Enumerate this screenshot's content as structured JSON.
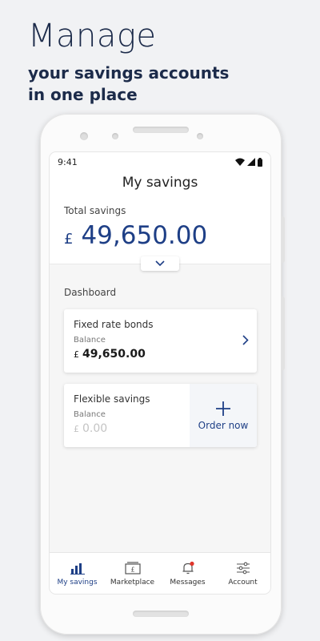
{
  "promo": {
    "headline": "Manage",
    "subline_1": "your savings accounts",
    "subline_2": "in one place"
  },
  "status_bar": {
    "time": "9:41"
  },
  "screen": {
    "title": "My savings",
    "total_label": "Total savings",
    "total_currency": "£",
    "total_amount": "49,650.00",
    "section_label": "Dashboard"
  },
  "cards": [
    {
      "name": "Fixed rate bonds",
      "balance_label": "Balance",
      "currency": "£",
      "amount": "49,650.00"
    },
    {
      "name": "Flexible savings",
      "balance_label": "Balance",
      "currency": "£",
      "amount": "0.00",
      "action_label": "Order now"
    }
  ],
  "nav": [
    {
      "label": "My savings",
      "icon": "bar-chart-icon",
      "active": true
    },
    {
      "label": "Marketplace",
      "icon": "marketplace-icon",
      "active": false
    },
    {
      "label": "Messages",
      "icon": "bell-icon",
      "active": false
    },
    {
      "label": "Account",
      "icon": "sliders-icon",
      "active": false
    }
  ],
  "colors": {
    "brand_navy": "#1e3f86",
    "headline": "#1c2b4a",
    "notification_dot": "#e0352b"
  }
}
